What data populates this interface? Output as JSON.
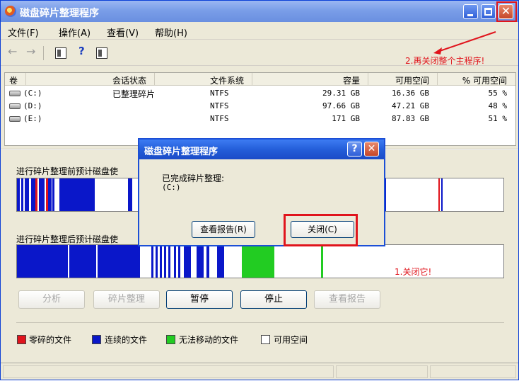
{
  "window": {
    "title": "磁盘碎片整理程序"
  },
  "menu": [
    "文件(F)",
    "操作(A)",
    "查看(V)",
    "帮助(H)"
  ],
  "toolbar": {
    "back_label": "←",
    "forward_label": "→"
  },
  "annotations": {
    "step2": "2.再关闭整个主程序!",
    "step1": "1.关闭它!"
  },
  "columns": [
    "卷",
    "会话状态",
    "文件系统",
    "容量",
    "可用空间",
    "% 可用空间"
  ],
  "volumes": [
    {
      "vol": "(C:)",
      "status": "已整理碎片",
      "fs": "NTFS",
      "capacity": "29.31 GB",
      "free": "16.36 GB",
      "pct": "55 %"
    },
    {
      "vol": "(D:)",
      "status": "",
      "fs": "NTFS",
      "capacity": "97.66 GB",
      "free": "47.21 GB",
      "pct": "48 %"
    },
    {
      "vol": "(E:)",
      "status": "",
      "fs": "NTFS",
      "capacity": "171 GB",
      "free": "87.83 GB",
      "pct": "51 %"
    }
  ],
  "sections": {
    "before": "进行碎片整理前预计磁盘使",
    "after": "进行碎片整理后预计磁盘使"
  },
  "buttons": {
    "analyze": "分析",
    "defrag": "碎片整理",
    "pause": "暂停",
    "stop": "停止",
    "report": "查看报告"
  },
  "legend": [
    "零碎的文件",
    "连续的文件",
    "无法移动的文件",
    "可用空间"
  ],
  "colors": {
    "fragmented": "#e0141c",
    "contiguous": "#0a17c9",
    "unmovable": "#22cc22",
    "free": "#ffffff"
  },
  "dialog": {
    "title": "磁盘碎片整理程序",
    "message": "已完成碎片整理:",
    "drive": "(C:)",
    "view_report": "查看报告(R)",
    "close": "关闭(C)"
  }
}
